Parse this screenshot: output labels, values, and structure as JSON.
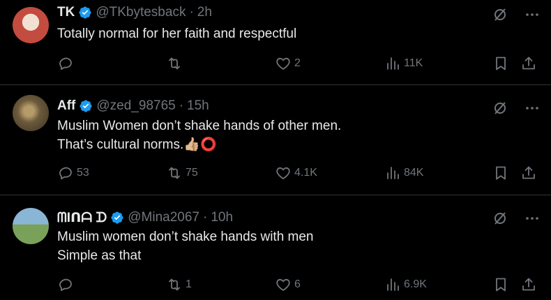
{
  "tweets": [
    {
      "name": "TK",
      "handle": "@TKbytesback",
      "dot": "·",
      "time": "2h",
      "text": "Totally normal for her faith  and respectful",
      "replies": "",
      "retweets": "",
      "likes": "2",
      "views": "11K"
    },
    {
      "name": "Aff",
      "handle": "@zed_98765",
      "dot": "·",
      "time": "15h",
      "text": "Muslim Women don’t shake hands of other men.\nThat’s cultural norms.",
      "emojis": [
        "👍🏼",
        "⭕"
      ],
      "replies": "53",
      "retweets": "75",
      "likes": "4.1K",
      "views": "84K"
    },
    {
      "name": "ᗰIᑎᗩ ᗪ",
      "handle": "@Mina2067",
      "dot": "·",
      "time": "10h",
      "text": "Muslim women don’t shake hands with men\nSimple as that",
      "replies": "",
      "retweets": "1",
      "likes": "6",
      "views": "6.9K"
    }
  ],
  "icons": {
    "verified": "verified-badge-icon",
    "grok": "grok-icon",
    "more": "more-icon",
    "reply": "reply-icon",
    "retweet": "retweet-icon",
    "like": "heart-icon",
    "views": "views-chart-icon",
    "bookmark": "bookmark-icon",
    "share": "share-icon"
  },
  "colors": {
    "background": "#000000",
    "text": "#e7e9ea",
    "muted": "#71767b",
    "verified": "#1d9bf0",
    "divider": "#2f3336"
  }
}
